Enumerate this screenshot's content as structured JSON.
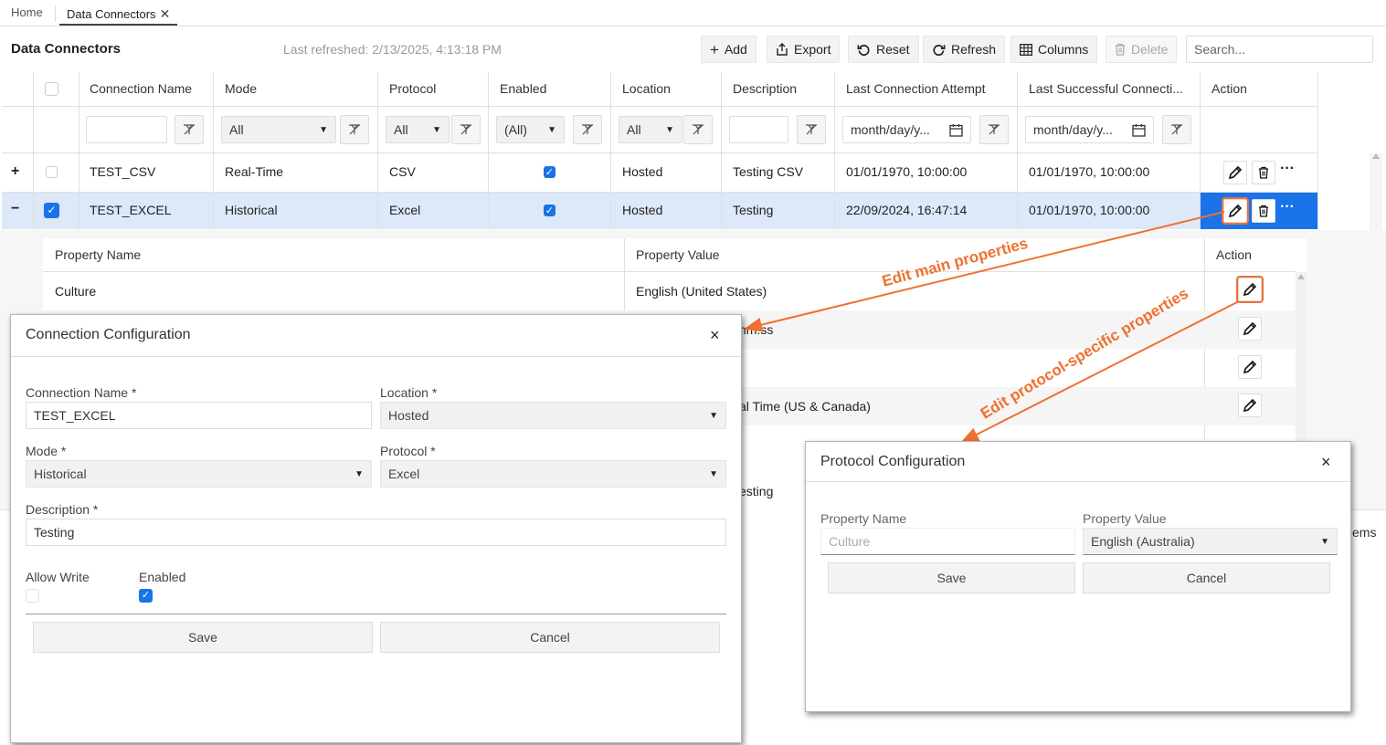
{
  "tabs": {
    "home": "Home",
    "active": "Data Connectors"
  },
  "page": {
    "title": "Data Connectors",
    "last_refreshed": "Last refreshed: 2/13/2025, 4:13:18 PM"
  },
  "toolbar": {
    "add": "Add",
    "export": "Export",
    "reset": "Reset",
    "refresh": "Refresh",
    "columns": "Columns",
    "delete": "Delete",
    "search_placeholder": "Search..."
  },
  "grid": {
    "columns": [
      "Connection Name",
      "Mode",
      "Protocol",
      "Enabled",
      "Location",
      "Description",
      "Last Connection Attempt",
      "Last Successful Connecti...",
      "Action"
    ],
    "filters": {
      "mode": "All",
      "protocol": "All",
      "enabled": "(All)",
      "location": "All",
      "date1": "month/day/y...",
      "date2": "month/day/y..."
    },
    "rows": [
      {
        "expander": "+",
        "name": "TEST_CSV",
        "mode": "Real-Time",
        "protocol": "CSV",
        "location": "Hosted",
        "description": "Testing CSV",
        "last_attempt": "01/01/1970, 10:00:00",
        "last_success": "01/01/1970, 10:00:00"
      },
      {
        "expander": "−",
        "name": "TEST_EXCEL",
        "mode": "Historical",
        "protocol": "Excel",
        "location": "Hosted",
        "description": "Testing",
        "last_attempt": "22/09/2024, 16:47:14",
        "last_success": "01/01/1970, 10:00:00"
      }
    ]
  },
  "detail": {
    "headers": [
      "Property Name",
      "Property Value",
      "Action"
    ],
    "rows": [
      {
        "name": "Culture",
        "value": "English (United States)"
      },
      {
        "value": "nm:ss"
      },
      {
        "value": ""
      },
      {
        "value": "al Time (US & Canada)"
      },
      {
        "value": ""
      },
      {
        "value": "esting"
      }
    ],
    "footer_fragment": "ems"
  },
  "annotations": {
    "main": "Edit main properties",
    "protocol": "Edit protocol-specific properties"
  },
  "conn_dialog": {
    "title": "Connection Configuration",
    "close": "×",
    "name_label": "Connection Name *",
    "name_value": "TEST_EXCEL",
    "location_label": "Location *",
    "location_value": "Hosted",
    "mode_label": "Mode *",
    "mode_value": "Historical",
    "protocol_label": "Protocol *",
    "protocol_value": "Excel",
    "description_label": "Description *",
    "description_value": "Testing",
    "allow_write_label": "Allow Write",
    "enabled_label": "Enabled",
    "save": "Save",
    "cancel": "Cancel"
  },
  "proto_dialog": {
    "title": "Protocol Configuration",
    "close": "×",
    "name_label": "Property Name",
    "name_value": "Culture",
    "value_label": "Property Value",
    "value_value": "English (Australia)",
    "save": "Save",
    "cancel": "Cancel"
  },
  "colors": {
    "accent": "#1a73e8",
    "selected_row": "#dde8f8",
    "annotation": "#f07030"
  }
}
